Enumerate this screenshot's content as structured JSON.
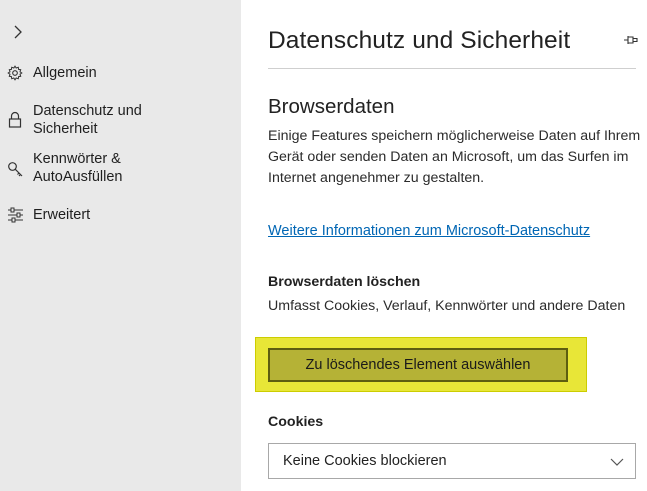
{
  "sidebar": {
    "items": [
      {
        "label": "Allgemein",
        "icon": "gear-icon"
      },
      {
        "label": "Datenschutz und Sicherheit",
        "icon": "lock-icon"
      },
      {
        "label": "Kennwörter & AutoAusfüllen",
        "icon": "key-icon"
      },
      {
        "label": "Erweitert",
        "icon": "sliders-icon"
      }
    ]
  },
  "main": {
    "title": "Datenschutz und Sicherheit",
    "browserdata": {
      "heading": "Browserdaten",
      "description": "Einige Features speichern möglicherweise Daten auf Ihrem Gerät oder senden Daten an Microsoft, um das Surfen im Internet angenehmer zu gestalten.",
      "link": "Weitere Informationen zum Microsoft-Datenschutz"
    },
    "clear": {
      "heading": "Browserdaten löschen",
      "description": "Umfasst Cookies, Verlauf, Kennwörter und andere Daten",
      "button": "Zu löschendes Element auswählen",
      "highlight_color": "#e8e637"
    },
    "cookies": {
      "heading": "Cookies",
      "selected": "Keine Cookies blockieren"
    }
  },
  "colors": {
    "sidebar_bg": "#e9e9e9",
    "link": "#0066b4",
    "button_bg": "#b5b236"
  }
}
